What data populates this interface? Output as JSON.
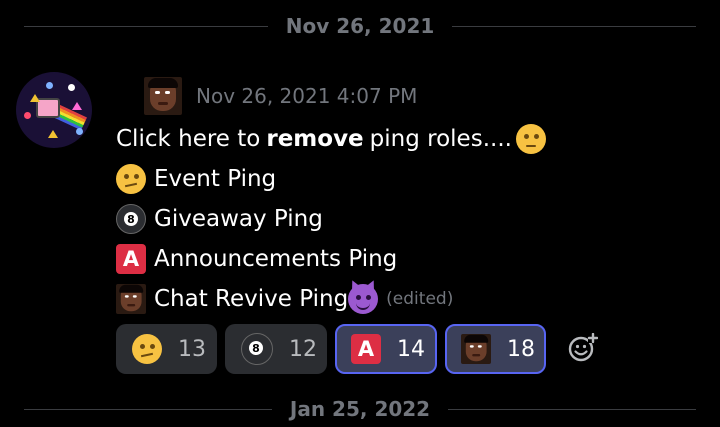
{
  "dividers": {
    "top": "Nov 26, 2021",
    "bottom": "Jan 25, 2022"
  },
  "message": {
    "timestamp": "Nov 26, 2021 4:07 PM",
    "line1_prefix": "Click here to",
    "line1_bold": "remove",
    "line1_suffix": "ping roles....",
    "line1_emoji": "pensive-face",
    "roles": [
      {
        "emoji": "face-with-raised-eyebrow",
        "label": "Event Ping"
      },
      {
        "emoji": "8-ball",
        "label": "Giveaway Ping"
      },
      {
        "emoji": "letter-a-button",
        "label": "Announcements Ping"
      },
      {
        "emoji": "custom-face",
        "label": "Chat Revive Ping"
      }
    ],
    "last_emoji": "smiling-devil",
    "edited": "(edited)"
  },
  "reactions": [
    {
      "emoji": "face-with-raised-eyebrow",
      "count": "13",
      "me": false
    },
    {
      "emoji": "8-ball",
      "count": "12",
      "me": false
    },
    {
      "emoji": "letter-a-button",
      "count": "14",
      "me": true
    },
    {
      "emoji": "custom-face",
      "count": "18",
      "me": true
    }
  ],
  "icons": {
    "add_reaction": "add-reaction-icon"
  },
  "colors": {
    "background": "#000000",
    "muted_text": "#72767d",
    "text": "#ffffff",
    "reaction_bg": "#2b2d31",
    "reaction_active_border": "#5865f2"
  },
  "glyphs": {
    "letter_a": "A",
    "eight": "8"
  }
}
